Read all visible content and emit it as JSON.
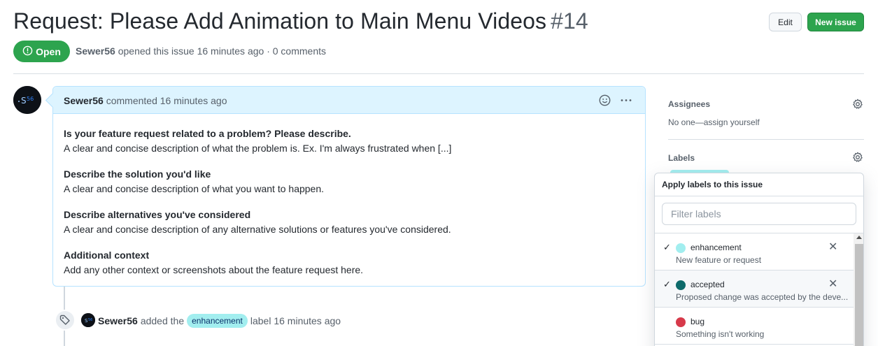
{
  "issue": {
    "title": "Request: Please Add Animation to Main Menu Videos",
    "number": "#14",
    "state": "Open",
    "author": "Sewer56",
    "meta_rest": "opened this issue 16 minutes ago · 0 comments"
  },
  "actions": {
    "edit_label": "Edit",
    "new_issue_label": "New issue"
  },
  "comment": {
    "author": "Sewer56",
    "action": "commented 16 minutes ago",
    "sections": [
      {
        "heading": "Is your feature request related to a problem? Please describe.",
        "text": "A clear and concise description of what the problem is. Ex. I'm always frustrated when [...]"
      },
      {
        "heading": "Describe the solution you'd like",
        "text": "A clear and concise description of what you want to happen."
      },
      {
        "heading": "Describe alternatives you've considered",
        "text": "A clear and concise description of any alternative solutions or features you've considered."
      },
      {
        "heading": "Additional context",
        "text": "Add any other context or screenshots about the feature request here."
      }
    ]
  },
  "event": {
    "actor": "Sewer56",
    "prefix": "added the",
    "label": "enhancement",
    "suffix": "label 16 minutes ago"
  },
  "sidebar": {
    "assignees_heading": "Assignees",
    "assignees_value": "No one—assign yourself",
    "labels_heading": "Labels"
  },
  "popover": {
    "title": "Apply labels to this issue",
    "filter_placeholder": "Filter labels",
    "items": [
      {
        "name": "enhancement",
        "desc": "New feature or request",
        "color": "#a2eeef",
        "checked": "✓",
        "remove": "✕"
      },
      {
        "name": "accepted",
        "desc": "Proposed change was accepted by the deve...",
        "color": "#0e6b6b",
        "checked": "✓",
        "remove": "✕"
      },
      {
        "name": "bug",
        "desc": "Something isn't working",
        "color": "#d73a4a",
        "checked": "",
        "remove": ""
      }
    ]
  },
  "colors": {
    "green": "#2da44e",
    "comment_border": "#b6e3ff",
    "comment_head_bg": "#ddf4ff"
  }
}
